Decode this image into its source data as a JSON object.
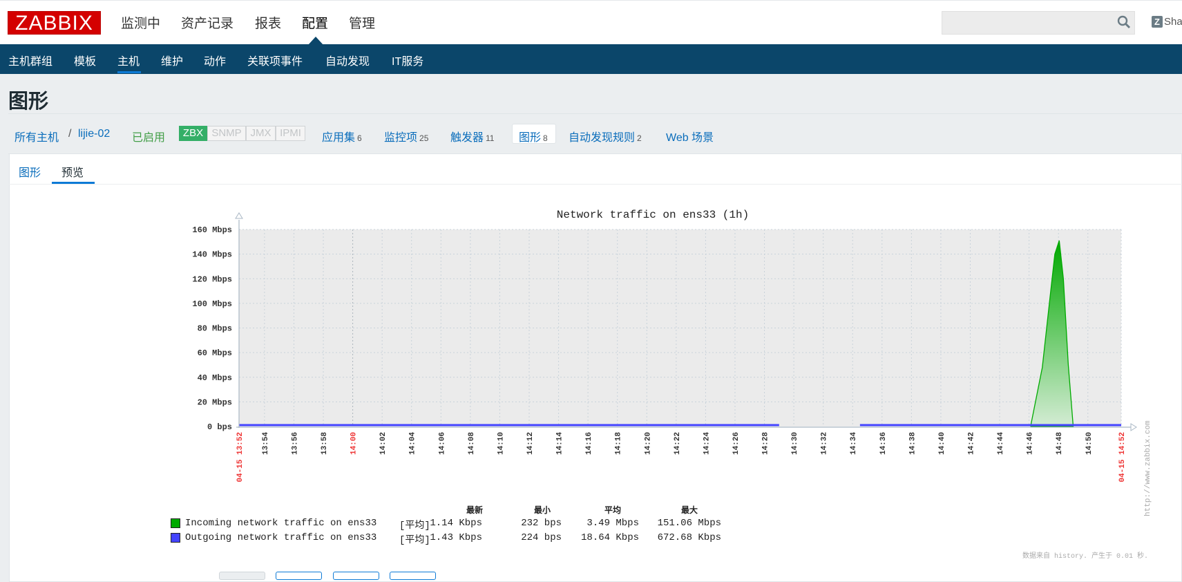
{
  "header": {
    "logo": "ZABBIX",
    "menu": [
      {
        "label": "监测中"
      },
      {
        "label": "资产记录"
      },
      {
        "label": "报表"
      },
      {
        "label": "配置",
        "active": true
      },
      {
        "label": "管理"
      }
    ],
    "search": {
      "value": "",
      "placeholder": ""
    },
    "share_label": "Sha"
  },
  "subnav": {
    "items": [
      {
        "label": "主机群组"
      },
      {
        "label": "模板"
      },
      {
        "label": "主机",
        "active": true
      },
      {
        "label": "维护"
      },
      {
        "label": "动作"
      },
      {
        "label": "关联项事件"
      },
      {
        "label": "自动发现"
      },
      {
        "label": "IT服务"
      }
    ]
  },
  "page_title": "图形",
  "host_nav": {
    "all_hosts": "所有主机",
    "separator": "/",
    "host": "lijie-02",
    "status": "已启用",
    "badges": [
      "ZBX",
      "SNMP",
      "JMX",
      "IPMI"
    ],
    "links": [
      {
        "label": "应用集",
        "count": "6"
      },
      {
        "label": "监控项",
        "count": "25"
      },
      {
        "label": "触发器",
        "count": "11"
      },
      {
        "label": "图形",
        "count": "8",
        "active": true
      },
      {
        "label": "自动发现规则",
        "count": "2"
      },
      {
        "label": "Web 场景",
        "count": ""
      }
    ]
  },
  "tabs": [
    {
      "label": "图形"
    },
    {
      "label": "预览",
      "active": true
    }
  ],
  "colors": {
    "brand": "#d40000",
    "nav": "#0b466a",
    "accent": "#0d7ad6",
    "enabled": "#34af67",
    "incoming": "#00aa00",
    "outgoing": "#4444ff"
  },
  "chart_data": {
    "type": "area",
    "title": "Network traffic on ens33 (1h)",
    "x_range": [
      "13:52:16",
      "14:52:16"
    ],
    "x_ticks": [
      "13:54",
      "13:56",
      "13:58",
      "14:00",
      "14:02",
      "14:04",
      "14:06",
      "14:08",
      "14:10",
      "14:12",
      "14:14",
      "14:16",
      "14:18",
      "14:20",
      "14:22",
      "14:24",
      "14:26",
      "14:28",
      "14:30",
      "14:32",
      "14:34",
      "14:36",
      "14:38",
      "14:40",
      "14:42",
      "14:44",
      "14:46",
      "14:48",
      "14:50"
    ],
    "x_start_label": "04-15 13:52",
    "x_end_label": "04-15 14:52",
    "highlight_ticks": [
      "14:00"
    ],
    "y_unit": "Mbps",
    "ylim": [
      0,
      160
    ],
    "y_ticks": [
      {
        "value": 0,
        "label": "0 bps"
      },
      {
        "value": 20,
        "label": "20 Mbps"
      },
      {
        "value": 40,
        "label": "40 Mbps"
      },
      {
        "value": 60,
        "label": "60 Mbps"
      },
      {
        "value": 80,
        "label": "80 Mbps"
      },
      {
        "value": 100,
        "label": "100 Mbps"
      },
      {
        "value": 120,
        "label": "120 Mbps"
      },
      {
        "value": 140,
        "label": "140 Mbps"
      },
      {
        "value": 160,
        "label": "160 Mbps"
      }
    ],
    "grid": true,
    "series": [
      {
        "name": "Incoming network traffic on ens33",
        "color": "#00aa00",
        "style": "filled",
        "points": [
          [
            "14:46:06",
            0
          ],
          [
            "14:46:54",
            48
          ],
          [
            "14:47:20",
            95
          ],
          [
            "14:47:45",
            140
          ],
          [
            "14:48:03",
            151.06
          ],
          [
            "14:48:20",
            120
          ],
          [
            "14:48:40",
            50
          ],
          [
            "14:49:00",
            0
          ]
        ]
      },
      {
        "name": "Outgoing network traffic on ens33",
        "color": "#4444ff",
        "style": "line",
        "segments": [
          [
            [
              "13:52:16",
              0.00143
            ],
            [
              "14:29:00",
              0.00143
            ]
          ],
          [
            [
              "14:34:30",
              0.00143
            ],
            [
              "14:52:16",
              0.00143
            ]
          ]
        ]
      }
    ],
    "legend": {
      "placement": "bottom",
      "headers": [
        "最新",
        "最小",
        "平均",
        "最大"
      ],
      "rows": [
        {
          "name": "Incoming network traffic on ens33",
          "func": "[平均]",
          "last": "1.14 Kbps",
          "min": "232 bps",
          "avg": "3.49 Mbps",
          "max": "151.06 Mbps",
          "color": "#00aa00"
        },
        {
          "name": "Outgoing network traffic on ens33",
          "func": "[平均]",
          "last": "1.43 Kbps",
          "min": "224 bps",
          "avg": "18.64 Kbps",
          "max": "672.68 Kbps",
          "color": "#4444ff"
        }
      ]
    },
    "watermark": "http://www.zabbix.com",
    "footer": "数据来自 history. 产生于 0.01 秒."
  }
}
